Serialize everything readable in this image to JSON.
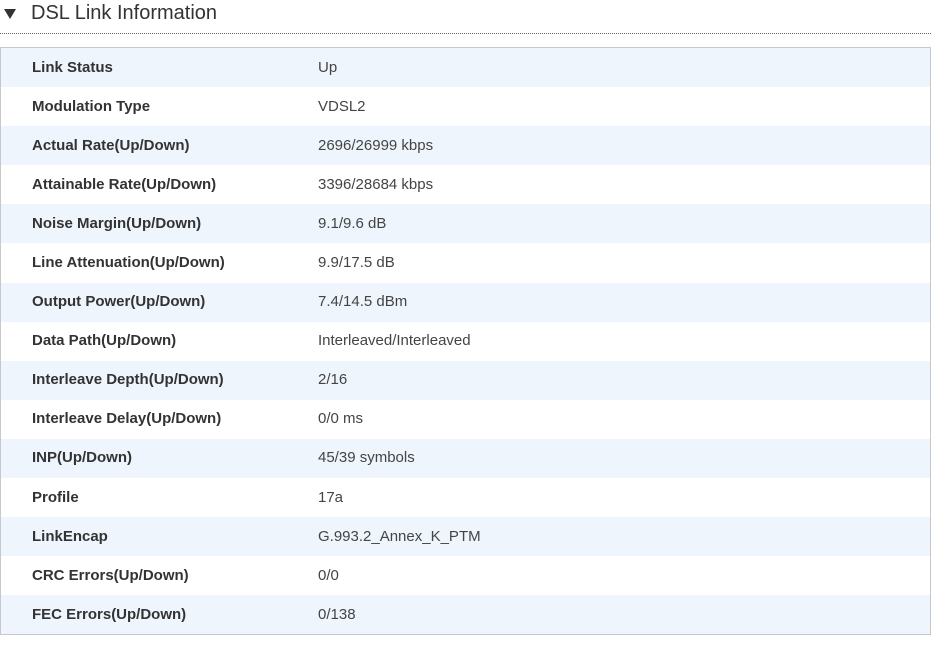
{
  "section": {
    "title": "DSL Link Information",
    "toggle_icon": "triangle-down-icon"
  },
  "rows": [
    {
      "label": "Link Status",
      "value": "Up"
    },
    {
      "label": "Modulation Type",
      "value": "VDSL2"
    },
    {
      "label": "Actual Rate(Up/Down)",
      "value": "2696/26999 kbps"
    },
    {
      "label": "Attainable Rate(Up/Down)",
      "value": "3396/28684 kbps"
    },
    {
      "label": "Noise Margin(Up/Down)",
      "value": "9.1/9.6 dB"
    },
    {
      "label": "Line Attenuation(Up/Down)",
      "value": "9.9/17.5 dB"
    },
    {
      "label": "Output Power(Up/Down)",
      "value": "7.4/14.5 dBm"
    },
    {
      "label": "Data Path(Up/Down)",
      "value": "Interleaved/Interleaved"
    },
    {
      "label": "Interleave Depth(Up/Down)",
      "value": "2/16"
    },
    {
      "label": "Interleave Delay(Up/Down)",
      "value": "0/0 ms"
    },
    {
      "label": "INP(Up/Down)",
      "value": "45/39 symbols"
    },
    {
      "label": "Profile",
      "value": "17a"
    },
    {
      "label": "LinkEncap",
      "value": "G.993.2_Annex_K_PTM"
    },
    {
      "label": "CRC Errors(Up/Down)",
      "value": "0/0"
    },
    {
      "label": "FEC Errors(Up/Down)",
      "value": "0/138"
    }
  ],
  "colors": {
    "row_alt_bg": "#eef5fd",
    "panel_border": "#c8c8c8",
    "text": "#333333"
  }
}
